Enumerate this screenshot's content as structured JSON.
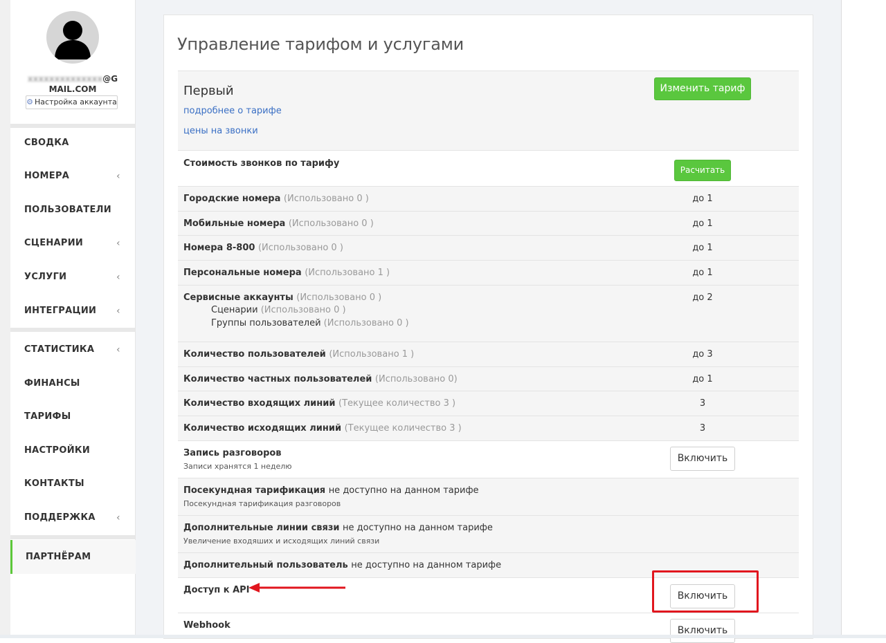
{
  "sidebar": {
    "email_hidden": "xxxxxxxxxxxxxx",
    "email_visible_1": "@G",
    "email_visible_2": "MAIL.COM",
    "account_settings": "Настройка аккаунта",
    "nav": [
      {
        "label": "СВОДКА"
      },
      {
        "label": "НОМЕРА"
      },
      {
        "label": "ПОЛЬЗОВАТЕЛИ"
      },
      {
        "label": "СЦЕНАРИИ"
      },
      {
        "label": "УСЛУГИ"
      },
      {
        "label": "ИНТЕГРАЦИИ"
      },
      {
        "label": "СТАТИСТИКА"
      },
      {
        "label": "ФИНАНСЫ"
      },
      {
        "label": "ТАРИФЫ"
      },
      {
        "label": "НАСТРОЙКИ"
      },
      {
        "label": "КОНТАКТЫ"
      },
      {
        "label": "ПОДДЕРЖКА"
      },
      {
        "label": "ПАРТНЁРАМ"
      }
    ],
    "chevron": "‹"
  },
  "page": {
    "title": "Управление тарифом и услугами"
  },
  "tariff": {
    "name": "Первый",
    "details_link": "подробнее о тарифе",
    "prices_link": "цены на звонки",
    "change_button": "Изменить тариф"
  },
  "calc": {
    "label": "Стоимость звонков по тарифу",
    "button": "Расчитать"
  },
  "rows": [
    {
      "name": "Городские номера",
      "used": "(Использовано 0 )",
      "value": "до 1"
    },
    {
      "name": "Мобильные номера",
      "used": "(Использовано 0 )",
      "value": "до 1"
    },
    {
      "name": "Номера 8-800",
      "used": "(Использовано 0 )",
      "value": "до 1"
    },
    {
      "name": "Персональные номера",
      "used": "(Использовано 1 )",
      "value": "до 1"
    },
    {
      "name": "Сервисные аккаунты",
      "used": "(Использовано 0 )",
      "value": "до 2",
      "children": [
        {
          "name": "Сценарии",
          "used": "(Использовано 0 )"
        },
        {
          "name": "Группы пользователей",
          "used": "(Использовано 0 )"
        }
      ]
    },
    {
      "name": "Количество пользователей",
      "used": "(Использовано 1 )",
      "value": "до 3"
    },
    {
      "name": "Количество частных пользователей",
      "used": "(Использовано 0)",
      "value": "до 1"
    },
    {
      "name": "Количество входящих линий",
      "used": "(Текущее количество 3 )",
      "value": "3"
    },
    {
      "name": "Количество исходящих линий",
      "used": "(Текущее количество 3 )",
      "value": "3"
    }
  ],
  "services": [
    {
      "name": "Запись разговоров",
      "sub": "Записи хранятся 1 неделю",
      "button": "Включить"
    },
    {
      "name": "Посекундная тарификация",
      "na": "не доступно на данном тарифе",
      "sub": "Посекундная тарификация разговоров"
    },
    {
      "name": "Дополнительные линии связи",
      "na": "не доступно на данном тарифе",
      "sub": "Увеличение входяших и исходящих линий связи"
    },
    {
      "name": "Дополнительный пользователь",
      "na": "не доступно на данном тарифе"
    },
    {
      "name": "Доступ к API",
      "button": "Включить"
    },
    {
      "name": "Webhook",
      "button": "Включить"
    }
  ],
  "colors": {
    "accent_green": "#5ac73e",
    "link_blue": "#3a6fc4",
    "annotation_red": "#e1161e"
  }
}
